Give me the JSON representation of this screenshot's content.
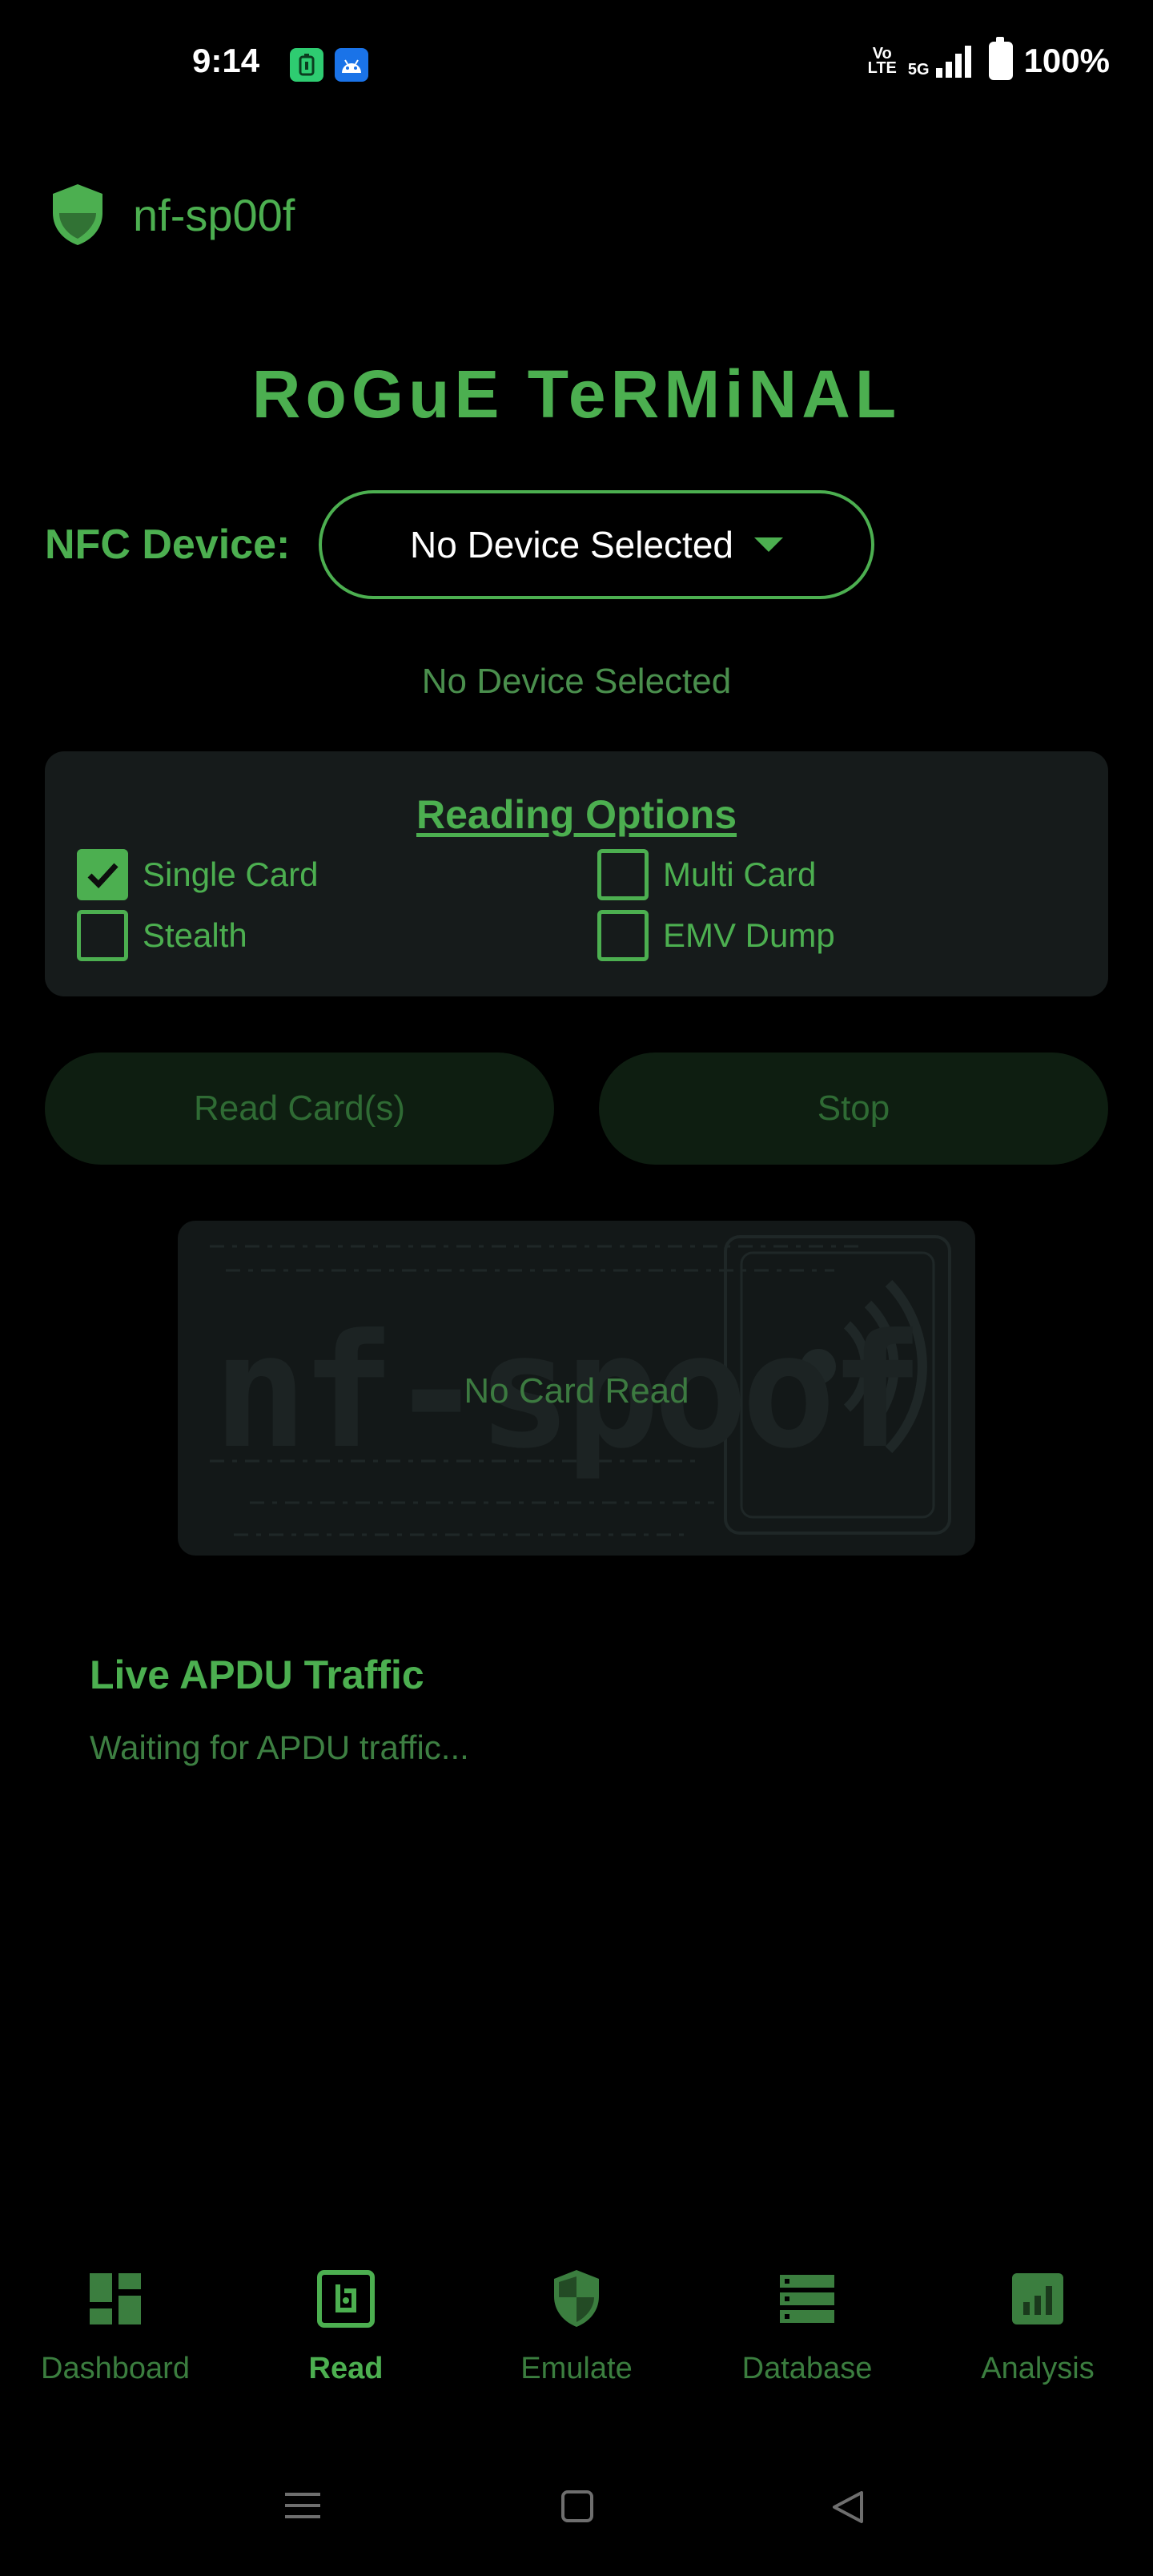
{
  "status_bar": {
    "time": "9:14",
    "network": "5G",
    "volte": "Vo\nLTE",
    "battery": "100%"
  },
  "header": {
    "app_name": "nf-sp00f",
    "logo_icon": "shield-icon"
  },
  "main": {
    "title": "RoGuE TeRMiNAL",
    "nfc_label": "NFC Device:",
    "nfc_select_value": "No Device Selected",
    "device_status": "No Device Selected",
    "reading_options": {
      "title": "Reading Options",
      "options": [
        {
          "label": "Single Card",
          "checked": true
        },
        {
          "label": "Multi Card",
          "checked": false
        },
        {
          "label": "Stealth",
          "checked": false
        },
        {
          "label": "EMV Dump",
          "checked": false
        }
      ]
    },
    "buttons": {
      "read": "Read Card(s)",
      "stop": "Stop"
    },
    "card_preview": {
      "watermark": "nf-spoof",
      "status": "No Card Read"
    },
    "apdu": {
      "title": "Live APDU Traffic",
      "status": "Waiting for APDU traffic..."
    }
  },
  "bottom_nav": [
    {
      "label": "Dashboard",
      "icon": "dashboard-icon",
      "active": false
    },
    {
      "label": "Read",
      "icon": "nfc-read-icon",
      "active": true
    },
    {
      "label": "Emulate",
      "icon": "shield-icon",
      "active": false
    },
    {
      "label": "Database",
      "icon": "database-icon",
      "active": false
    },
    {
      "label": "Analysis",
      "icon": "analytics-icon",
      "active": false
    }
  ],
  "colors": {
    "accent": "#4caf50",
    "background": "#000000",
    "card": "#161b1b",
    "button_disabled": "#0e1e11"
  }
}
